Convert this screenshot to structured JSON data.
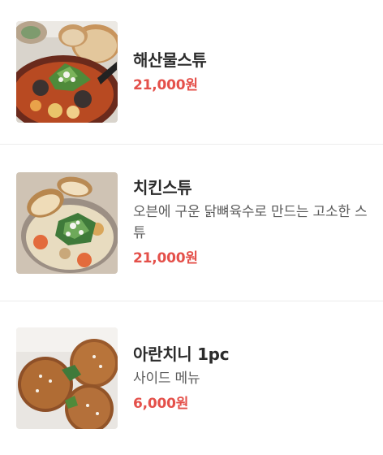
{
  "menu": {
    "items": [
      {
        "name": "해산물스튜",
        "description": "",
        "price": "21,000원",
        "image": "seafood-stew-photo"
      },
      {
        "name": "치킨스튜",
        "description": "오븐에 구운 닭뼈육수로 만드는 고소한 스튜",
        "price": "21,000원",
        "image": "chicken-stew-photo"
      },
      {
        "name": "아란치니 1pc",
        "description": "사이드 메뉴",
        "price": "6,000원",
        "image": "arancini-photo"
      }
    ]
  },
  "colors": {
    "price": "#e4504a",
    "divider": "#ececec",
    "name": "#2b2b2b",
    "description": "#5c5c5c"
  }
}
